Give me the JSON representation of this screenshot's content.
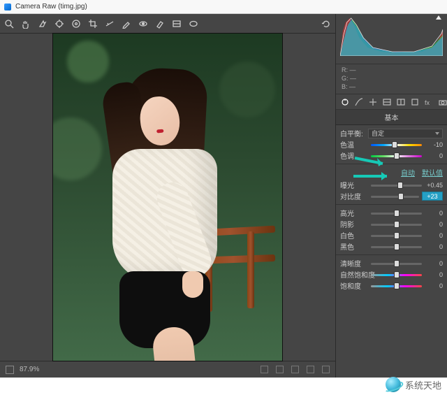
{
  "window": {
    "title": "Camera Raw (timg.jpg)"
  },
  "status": {
    "zoom": "87.9%"
  },
  "rgb": {
    "r": "R:  —",
    "g": "G:  —",
    "b": "B:  —"
  },
  "panel": {
    "title": "基本",
    "wb_label": "白平衡:",
    "wb_value": "自定",
    "auto": "自动",
    "default": "默认值",
    "sliders": {
      "temp": {
        "label": "色温",
        "value": "-10",
        "pos": 46
      },
      "tint": {
        "label": "色调",
        "value": "0",
        "pos": 50
      },
      "exposure": {
        "label": "曝光",
        "value": "+0.45",
        "pos": 58
      },
      "contrast": {
        "label": "对比度",
        "value": "+23",
        "pos": 62
      },
      "highlights": {
        "label": "高光",
        "value": "0",
        "pos": 50
      },
      "shadows": {
        "label": "阴影",
        "value": "0",
        "pos": 50
      },
      "whites": {
        "label": "白色",
        "value": "0",
        "pos": 50
      },
      "blacks": {
        "label": "黑色",
        "value": "0",
        "pos": 50
      },
      "clarity": {
        "label": "清晰度",
        "value": "0",
        "pos": 50
      },
      "vibrance": {
        "label": "自然饱和度",
        "value": "0",
        "pos": 50
      },
      "saturation": {
        "label": "饱和度",
        "value": "0",
        "pos": 50
      }
    }
  },
  "watermark": {
    "text": "系统天地"
  }
}
